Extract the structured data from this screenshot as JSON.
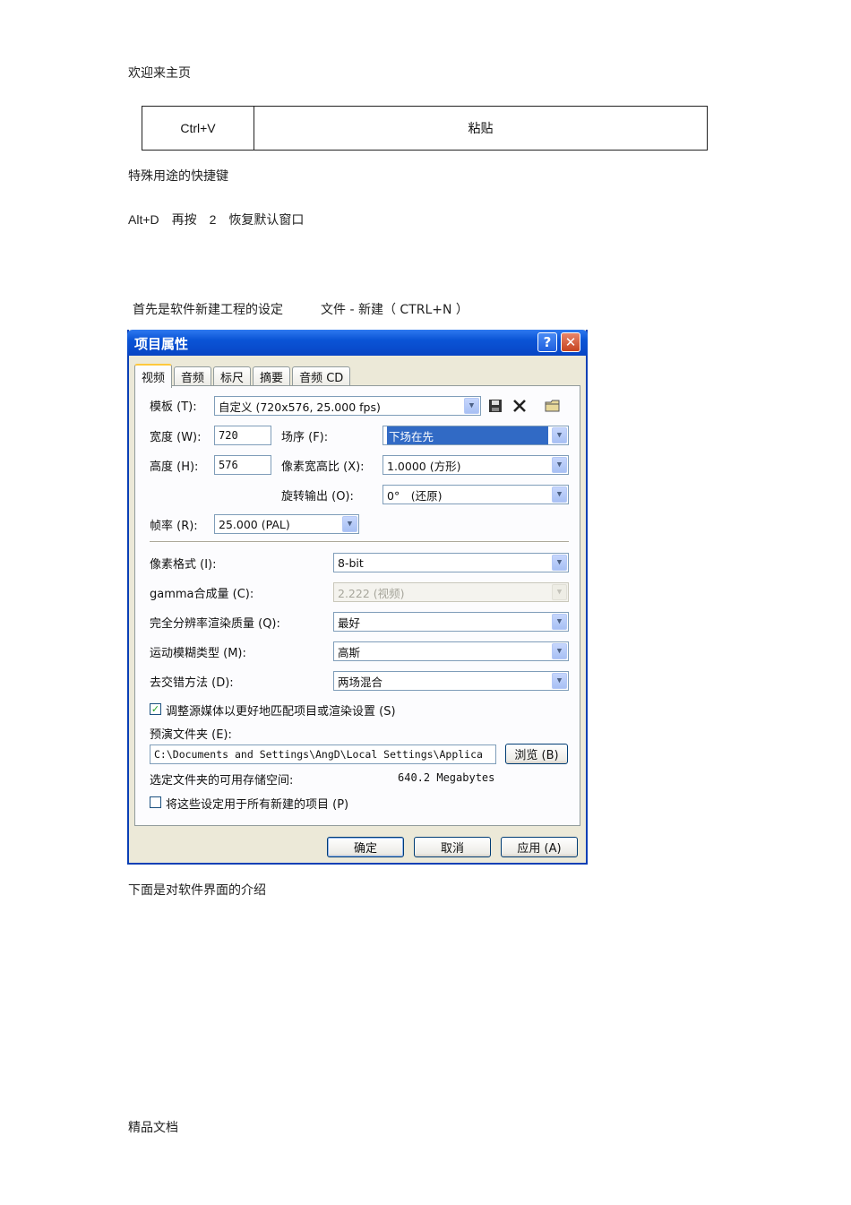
{
  "doc": {
    "header": "欢迎来主页",
    "table": {
      "key": "Ctrl+V",
      "action": "粘贴"
    },
    "section_title": "特殊用途的快捷键",
    "shortcut_line": "Alt+D　再按　2　恢复默认窗口",
    "intro_line": "首先是软件新建工程的设定　　　文件 - 新建（ CTRL+N ）",
    "after_dialog": "下面是对软件界面的介绍",
    "footer": "精品文档"
  },
  "dialog": {
    "title": "项目属性",
    "help_glyph": "?",
    "close_glyph": "✕",
    "tabs": [
      "视频",
      "音频",
      "标尺",
      "摘要",
      "音频 CD"
    ],
    "template": {
      "label": "模板 (T):",
      "value": "自定义 (720x576, 25.000 fps)"
    },
    "width": {
      "label": "宽度 (W):",
      "value": "720"
    },
    "height": {
      "label": "高度 (H):",
      "value": "576"
    },
    "field_order": {
      "label": "场序 (F):",
      "value": "下场在先"
    },
    "pixel_aspect": {
      "label": "像素宽高比 (X):",
      "value": "1.0000 (方形)"
    },
    "rotation": {
      "label": "旋转输出 (O):",
      "value": "0°　(还原)"
    },
    "frame_rate": {
      "label": "帧率 (R):",
      "value": "25.000 (PAL)"
    },
    "pixel_format": {
      "label": "像素格式 (I):",
      "value": "8-bit"
    },
    "gamma": {
      "label": "gamma合成量 (C):",
      "value": "2.222 (视频)"
    },
    "render_quality": {
      "label": "完全分辨率渲染质量 (Q):",
      "value": "最好"
    },
    "motion_blur": {
      "label": "运动模糊类型 (M):",
      "value": "高斯"
    },
    "deinterlace": {
      "label": "去交错方法 (D):",
      "value": "两场混合"
    },
    "adjust_source": {
      "label": "调整源媒体以更好地匹配项目或渲染设置 (S)",
      "checked": true,
      "mark": "✓"
    },
    "prerender": {
      "label": "预演文件夹 (E):",
      "value": "C:\\Documents and Settings\\AngD\\Local Settings\\Applica",
      "browse": "浏览 (B)"
    },
    "free_space": {
      "label": "选定文件夹的可用存储空间:",
      "value": "640.2 Megabytes"
    },
    "apply_all": {
      "label": "将这些设定用于所有新建的项目 (P)",
      "checked": false
    },
    "buttons": {
      "ok": "确定",
      "cancel": "取消",
      "apply": "应用 (A)"
    },
    "arrow_glyph": "▼"
  }
}
